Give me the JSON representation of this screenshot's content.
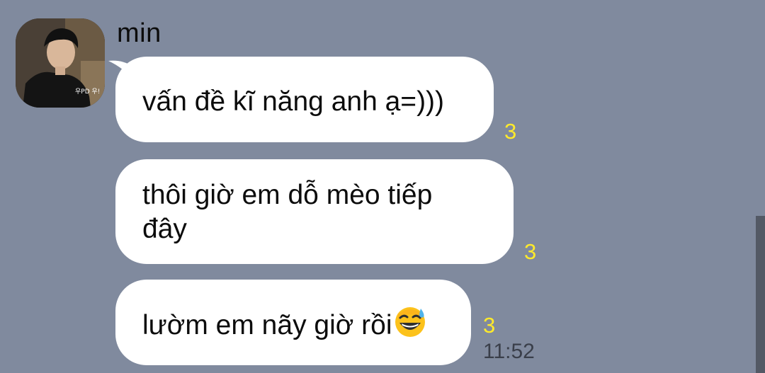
{
  "chat": {
    "sender": {
      "name": "min",
      "avatar_caption": "우PD 우!"
    },
    "messages": [
      {
        "text": "vấn đề kĩ năng anh ạ=)))",
        "unread": "3"
      },
      {
        "text": "thôi giờ em dỗ mèo tiếp",
        "text_line2": "đây",
        "unread": "3"
      },
      {
        "text": "lườm em nãy giờ rồi",
        "emoji": "grinning-face-with-sweat",
        "unread": "3",
        "time": "11:52"
      }
    ]
  },
  "colors": {
    "background": "#808a9e",
    "bubble": "#ffffff",
    "unread": "#ffea2b",
    "time": "#3a3f4a"
  }
}
